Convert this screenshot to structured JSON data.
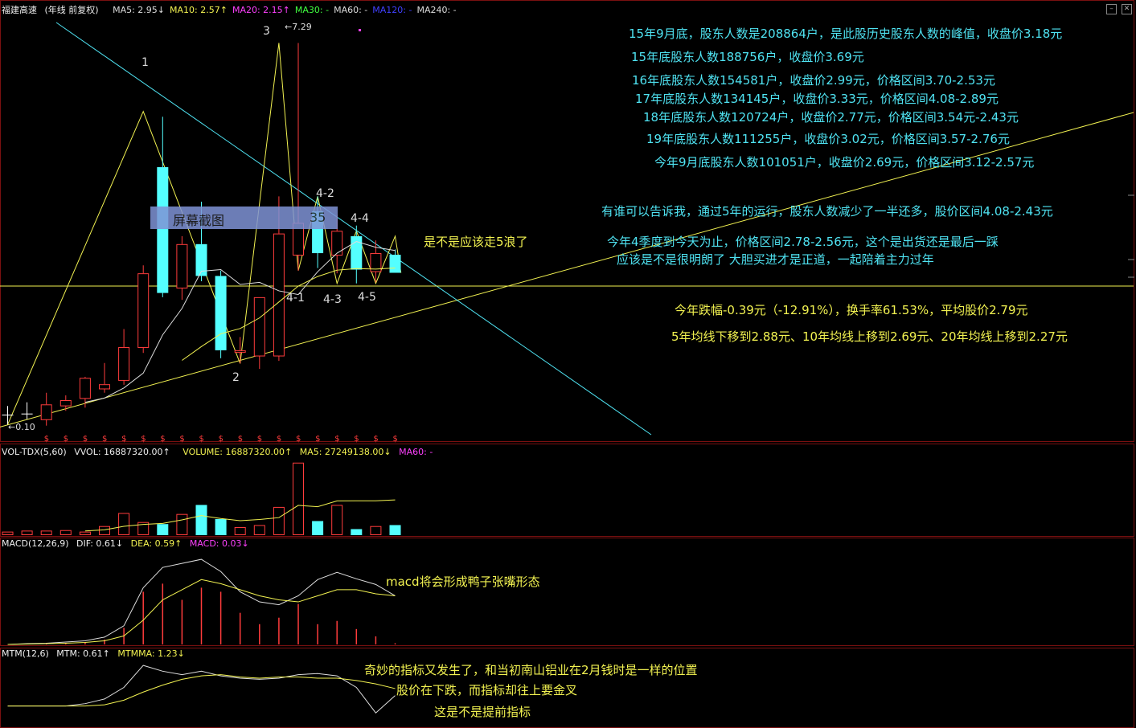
{
  "header": {
    "stock": "福建高速",
    "mode": "(年线 前复权)",
    "ma": [
      {
        "label": "MA5: 2.95↓",
        "color": "#dddddd"
      },
      {
        "label": "MA10: 2.57↑",
        "color": "#f2f251"
      },
      {
        "label": "MA20: 2.15↑",
        "color": "#ff40ff"
      },
      {
        "label": "MA30: -",
        "color": "#40ff40"
      },
      {
        "label": "MA60: -",
        "color": "#dddddd"
      },
      {
        "label": "MA120: -",
        "color": "#4040ff"
      },
      {
        "label": "MA240: -",
        "color": "#dddddd"
      }
    ]
  },
  "vol_header": {
    "name": "VOL-TDX(5,60)",
    "vvol": "VVOL: 16887320.00↑",
    "volume": "VOLUME: 16887320.00↑",
    "ma5": "MA5: 27249138.00↓",
    "ma60": "MA60: -"
  },
  "macd_header": {
    "name": "MACD(12,26,9)",
    "dif": "DIF: 0.61↓",
    "dea": "DEA: 0.59↑",
    "macd": "MACD: 0.03↓"
  },
  "mtm_header": {
    "name": "MTM(12,6)",
    "mtm": "MTM: 0.61↑",
    "mtmma": "MTMMA: 1.23↓"
  },
  "screenshot_label": "屏幕截图",
  "screenshot_num": "35",
  "annotations": {
    "high": "7.29",
    "low": "0.10",
    "waves": [
      "1",
      "2",
      "3",
      "4-1",
      "4-2",
      "4-3",
      "4-4",
      "4-5"
    ]
  },
  "notes_cyan": [
    "15年9月底，股东人数是208864户，是此股历史股东人数的峰值，收盘价3.18元",
    "15年底股东人数188756户，收盘价3.69元",
    "16年底股东人数154581户，收盘价2.99元，价格区间3.70-2.53元",
    "17年底股东人数134145户，收盘价3.33元，价格区间4.08-2.89元",
    "18年底股东人数120724户，收盘价2.77元，价格区间3.54元-2.43元",
    "19年底股东人数111255户，收盘价3.02元，价格区间3.57-2.76元",
    "今年9月底股东人数101051户，收盘价2.69元，价格区间3.12-2.57元",
    "有谁可以告诉我，通过5年的运行，股东人数减少了一半还多，股价区间4.08-2.43元",
    "今年4季度到今天为止，价格区间2.78-2.56元，这个是出货还是最后一踩",
    "应该是不是很明朗了        大胆买进才是正道，一起陪着主力过年"
  ],
  "notes_yellow": {
    "wave5": "是不是应该走5浪了",
    "ytd": "今年跌幅-0.39元（-12.91%），换手率61.53%，平均股价2.79元",
    "ma_move": "5年均线下移到2.88元、10年均线上移到2.69元、20年均线上移到2.27元",
    "macd_note": "macd将会形成鸭子张嘴形态",
    "mtm_note1": "奇妙的指标又发生了，和当初南山铝业在2月钱时是一样的位置",
    "mtm_note2": "股价在下跌，而指标却往上要金叉",
    "mtm_note3": "这是不是提前指标"
  },
  "colors": {
    "up": "#ff3c3c",
    "down": "#54ffff",
    "ma5": "#dddddd",
    "ma10": "#f2f251",
    "ma20": "#ff40ff",
    "trend": "#f2f251",
    "trend_down": "#4fe3f2"
  },
  "chart_data": [
    {
      "type": "candlestick",
      "title": "福建高速 (年线 前复权)",
      "y_ticks_shown": false,
      "candles": [
        {
          "o": 0.11,
          "h": 0.45,
          "l": 0.1,
          "c": 0.28
        },
        {
          "o": 0.28,
          "h": 0.52,
          "l": 0.2,
          "c": 0.3
        },
        {
          "o": 0.2,
          "h": 0.7,
          "l": 0.08,
          "c": 0.48
        },
        {
          "o": 0.46,
          "h": 0.65,
          "l": 0.36,
          "c": 0.56
        },
        {
          "o": 0.6,
          "h": 1.0,
          "l": 0.42,
          "c": 0.98
        },
        {
          "o": 0.78,
          "h": 1.26,
          "l": 0.7,
          "c": 0.86
        },
        {
          "o": 0.94,
          "h": 1.9,
          "l": 0.85,
          "c": 1.56
        },
        {
          "o": 1.56,
          "h": 3.1,
          "l": 1.45,
          "c": 2.95
        },
        {
          "o": 4.95,
          "h": 5.9,
          "l": 2.5,
          "c": 2.58
        },
        {
          "o": 2.68,
          "h": 3.65,
          "l": 2.45,
          "c": 3.5
        },
        {
          "o": 3.5,
          "h": 4.3,
          "l": 2.8,
          "c": 2.9
        },
        {
          "o": 2.9,
          "h": 3.0,
          "l": 1.35,
          "c": 1.5
        },
        {
          "o": 1.47,
          "h": 1.75,
          "l": 1.25,
          "c": 1.5
        },
        {
          "o": 1.4,
          "h": 2.5,
          "l": 1.15,
          "c": 2.5
        },
        {
          "o": 1.4,
          "h": 4.4,
          "l": 1.3,
          "c": 3.7
        },
        {
          "o": 3.3,
          "h": 7.29,
          "l": 3.0,
          "c": 3.9
        },
        {
          "o": 4.12,
          "h": 4.4,
          "l": 3.05,
          "c": 3.33
        },
        {
          "o": 3.3,
          "h": 4.05,
          "l": 2.95,
          "c": 3.75
        },
        {
          "o": 3.65,
          "h": 3.85,
          "l": 2.76,
          "c": 3.02
        },
        {
          "o": 2.99,
          "h": 3.57,
          "l": 2.78,
          "c": 3.33
        },
        {
          "o": 3.3,
          "h": 3.4,
          "l": 2.96,
          "c": 2.96
        }
      ],
      "ma5": [
        null,
        null,
        null,
        null,
        0.52,
        0.6,
        0.79,
        1.07,
        1.79,
        2.29,
        2.99,
        3.02,
        2.74,
        2.78,
        2.62,
        2.55,
        2.98,
        3.33,
        3.55,
        3.44,
        3.38
      ],
      "ma10": [
        null,
        null,
        null,
        null,
        null,
        null,
        null,
        null,
        null,
        1.31,
        1.57,
        1.81,
        1.91,
        2.11,
        2.41,
        2.71,
        2.89,
        3.01,
        3.04,
        3.03,
        3.05
      ],
      "ymin": 0,
      "ymax": 7.6
    },
    {
      "type": "bar",
      "title": "VOL-TDX(5,60)",
      "values": [
        3.5,
        4.5,
        4.5,
        5,
        3.5,
        9,
        22,
        13,
        11,
        21,
        30,
        16,
        8,
        10,
        28,
        72,
        14,
        30,
        6,
        9,
        10
      ],
      "ma5_line": [
        null,
        null,
        null,
        null,
        4.2,
        5.3,
        8.8,
        10.7,
        11.7,
        15.2,
        19.4,
        16.6,
        14.4,
        15.6,
        17.4,
        29.6,
        28.2,
        34.0,
        34.1,
        34.1,
        35.0
      ],
      "ylim": [
        0,
        75
      ],
      "unit": "million shares"
    },
    {
      "type": "bar",
      "title": "MACD(12,26,9)",
      "macd": [
        0.0,
        0.02,
        0.03,
        0.04,
        0.06,
        0.12,
        0.41,
        1.3,
        1.5,
        1.1,
        1.4,
        1.3,
        0.78,
        0.5,
        0.66,
        1.0,
        0.5,
        0.58,
        0.38,
        0.2,
        0.03
      ],
      "dif": [
        0.0,
        0.02,
        0.03,
        0.06,
        0.09,
        0.18,
        0.46,
        1.4,
        1.9,
        2.0,
        2.1,
        1.8,
        1.3,
        1.05,
        0.98,
        1.2,
        1.6,
        1.78,
        1.62,
        1.48,
        1.2
      ],
      "dea": [
        0.0,
        0.01,
        0.02,
        0.03,
        0.05,
        0.09,
        0.21,
        0.6,
        1.1,
        1.35,
        1.6,
        1.5,
        1.35,
        1.2,
        1.1,
        1.05,
        1.2,
        1.35,
        1.35,
        1.25,
        1.2
      ],
      "ylim": [
        0,
        2.3
      ]
    },
    {
      "type": "line",
      "title": "MTM(12,6)",
      "mtm": [
        0.0,
        0.0,
        0.0,
        0.0,
        0.2,
        0.6,
        1.6,
        3.5,
        3.0,
        2.7,
        3.0,
        2.6,
        2.4,
        2.3,
        2.4,
        2.7,
        2.8,
        2.6,
        1.6,
        -0.6,
        0.9
      ],
      "mtmma": [
        0.0,
        0.0,
        0.0,
        0.0,
        0.0,
        0.1,
        0.5,
        1.2,
        1.8,
        2.3,
        2.6,
        2.7,
        2.5,
        2.4,
        2.5,
        2.5,
        2.4,
        2.4,
        2.2,
        1.9,
        1.5
      ],
      "ylim": [
        -1.0,
        4.2
      ]
    }
  ]
}
